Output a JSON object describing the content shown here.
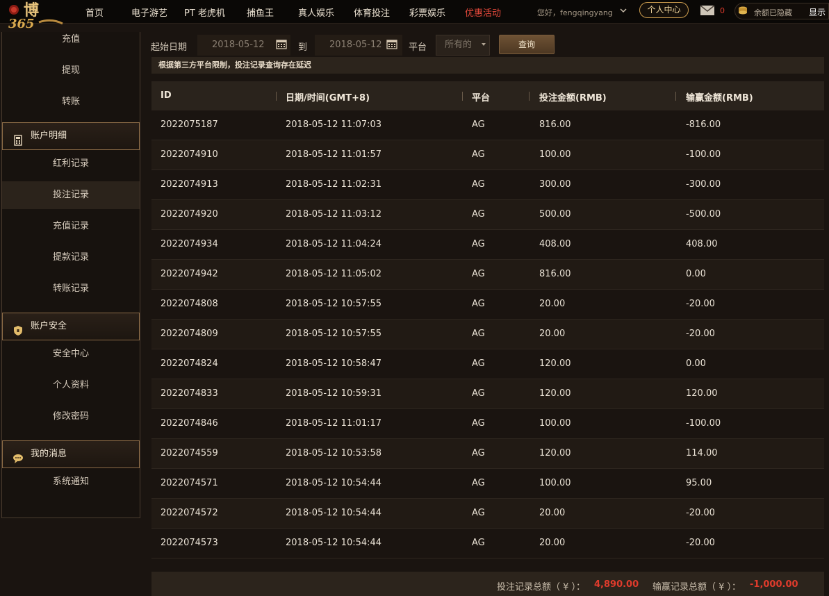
{
  "header": {
    "logo_text": "博365",
    "nav": [
      {
        "label": "首页",
        "promo": false
      },
      {
        "label": "电子游艺",
        "promo": false
      },
      {
        "label": "PT 老虎机",
        "promo": false
      },
      {
        "label": "捕鱼王",
        "promo": false
      },
      {
        "label": "真人娱乐",
        "promo": false
      },
      {
        "label": "体育投注",
        "promo": false
      },
      {
        "label": "彩票娱乐",
        "promo": false
      },
      {
        "label": "优惠活动",
        "promo": true
      }
    ],
    "greeting": "您好，fengqingyang",
    "personal_center": "个人中心",
    "mail_count": "0",
    "balance_text": "余额已隐藏",
    "show_label": "显示"
  },
  "sidebar": {
    "top_links": [
      "充值",
      "提现",
      "转账"
    ],
    "sections": [
      {
        "title": "账户明细",
        "icon": "calculator-icon",
        "items": [
          "红利记录",
          "投注记录",
          "充值记录",
          "提款记录",
          "转账记录"
        ],
        "active": "投注记录"
      },
      {
        "title": "账户安全",
        "icon": "shield-icon",
        "items": [
          "安全中心",
          "个人资料",
          "修改密码"
        ]
      },
      {
        "title": "我的消息",
        "icon": "chat-icon",
        "items": [
          "系统通知"
        ]
      }
    ]
  },
  "filter": {
    "start_label": "起始日期",
    "start_value": "2018-05-12",
    "to_label": "到",
    "end_value": "2018-05-12",
    "platform_label": "平台",
    "platform_value": "所有的",
    "query_label": "查询"
  },
  "notice": "根据第三方平台限制，投注记录查询存在延迟",
  "table": {
    "columns": [
      "ID",
      "日期/时间(GMT+8)",
      "平台",
      "投注金额(RMB)",
      "输赢金额(RMB)"
    ],
    "rows": [
      [
        "2022075187",
        "2018-05-12 11:07:03",
        "AG",
        "816.00",
        "-816.00"
      ],
      [
        "2022074910",
        "2018-05-12 11:01:57",
        "AG",
        "100.00",
        "-100.00"
      ],
      [
        "2022074913",
        "2018-05-12 11:02:31",
        "AG",
        "300.00",
        "-300.00"
      ],
      [
        "2022074920",
        "2018-05-12 11:03:12",
        "AG",
        "500.00",
        "-500.00"
      ],
      [
        "2022074934",
        "2018-05-12 11:04:24",
        "AG",
        "408.00",
        "408.00"
      ],
      [
        "2022074942",
        "2018-05-12 11:05:02",
        "AG",
        "816.00",
        "0.00"
      ],
      [
        "2022074808",
        "2018-05-12 10:57:55",
        "AG",
        "20.00",
        "-20.00"
      ],
      [
        "2022074809",
        "2018-05-12 10:57:55",
        "AG",
        "20.00",
        "-20.00"
      ],
      [
        "2022074824",
        "2018-05-12 10:58:47",
        "AG",
        "120.00",
        "0.00"
      ],
      [
        "2022074833",
        "2018-05-12 10:59:31",
        "AG",
        "120.00",
        "120.00"
      ],
      [
        "2022074846",
        "2018-05-12 11:01:17",
        "AG",
        "100.00",
        "-100.00"
      ],
      [
        "2022074559",
        "2018-05-12 10:53:58",
        "AG",
        "120.00",
        "114.00"
      ],
      [
        "2022074571",
        "2018-05-12 10:54:44",
        "AG",
        "100.00",
        "95.00"
      ],
      [
        "2022074572",
        "2018-05-12 10:54:44",
        "AG",
        "20.00",
        "-20.00"
      ],
      [
        "2022074573",
        "2018-05-12 10:54:44",
        "AG",
        "20.00",
        "-20.00"
      ]
    ]
  },
  "totals": {
    "bet_label": "投注记录总额（ ¥ ）：",
    "bet_value": "4,890.00",
    "win_label": "输赢记录总额（ ¥ ）：",
    "win_value": "-1,000.00"
  },
  "colors": {
    "accent_gold": "#c99a4d",
    "promo_red": "#e84a3c",
    "total_red": "#e03b2c"
  }
}
